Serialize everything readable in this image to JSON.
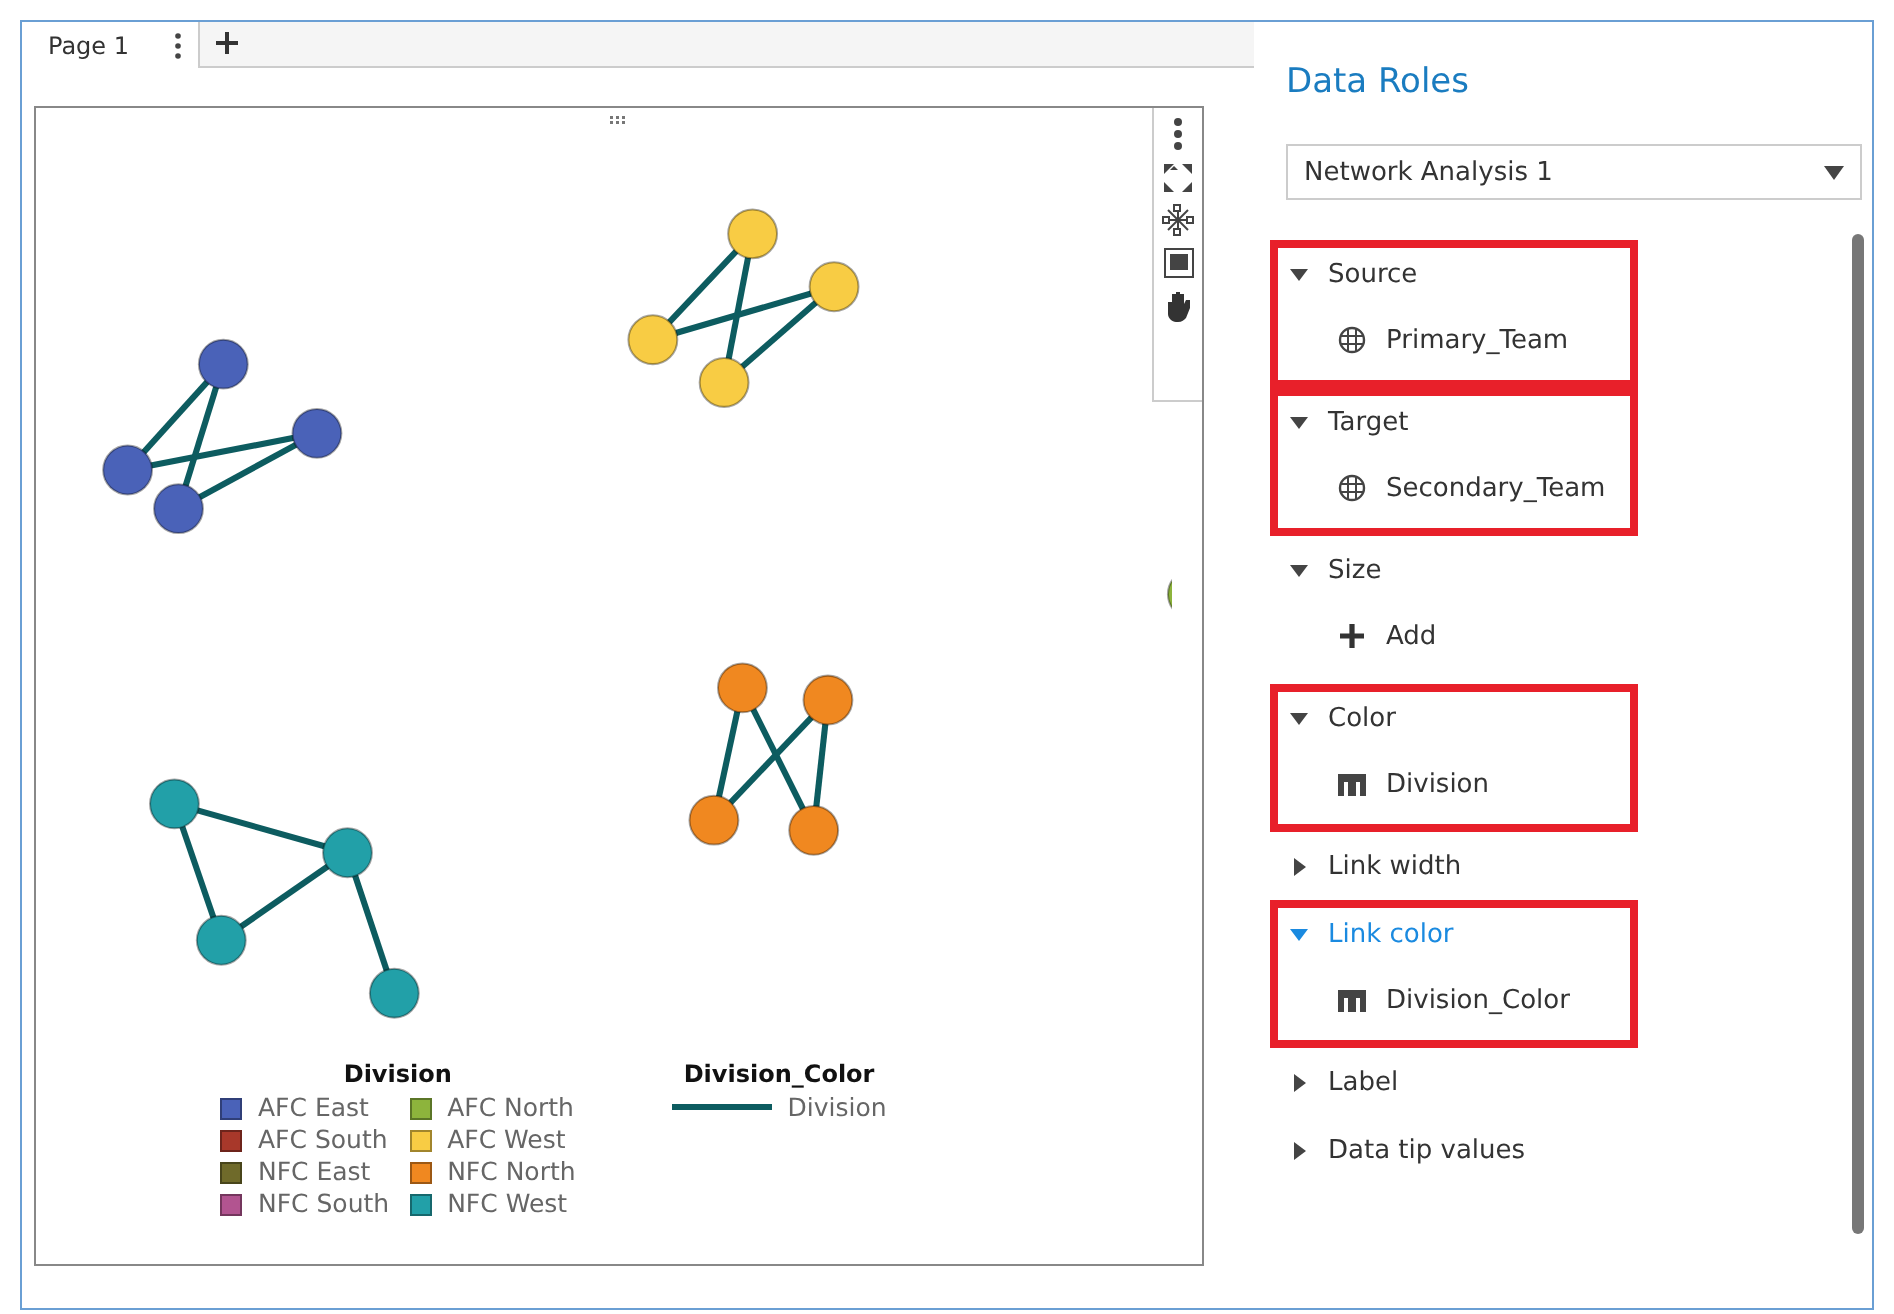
{
  "tabs": [
    {
      "label": "Page 1",
      "selected": true
    }
  ],
  "legend": {
    "title": "Division",
    "items": [
      {
        "label": "AFC East",
        "color": "#4a62b8"
      },
      {
        "label": "AFC North",
        "color": "#8db43c"
      },
      {
        "label": "AFC South",
        "color": "#a8382a"
      },
      {
        "label": "AFC West",
        "color": "#f8cc44"
      },
      {
        "label": "NFC East",
        "color": "#6f6a2a"
      },
      {
        "label": "NFC North",
        "color": "#f08820"
      },
      {
        "label": "NFC South",
        "color": "#b25490"
      },
      {
        "label": "NFC West",
        "color": "#22a0a8"
      }
    ]
  },
  "link_legend": {
    "title": "Division_Color",
    "label": "Division",
    "color": "#0d5c60"
  },
  "panel": {
    "title": "Data Roles",
    "dropdown": "Network Analysis 1",
    "roles": [
      {
        "label": "Source",
        "expanded": true,
        "highlighted": true,
        "selected": false,
        "item": {
          "kind": "field",
          "label": "Primary_Team"
        }
      },
      {
        "label": "Target",
        "expanded": true,
        "highlighted": true,
        "selected": false,
        "item": {
          "kind": "field",
          "label": "Secondary_Team"
        }
      },
      {
        "label": "Size",
        "expanded": true,
        "highlighted": false,
        "selected": false,
        "item": {
          "kind": "add",
          "label": "Add"
        }
      },
      {
        "label": "Color",
        "expanded": true,
        "highlighted": true,
        "selected": false,
        "item": {
          "kind": "category",
          "label": "Division"
        }
      },
      {
        "label": "Link width",
        "expanded": false,
        "highlighted": false,
        "selected": false
      },
      {
        "label": "Link color",
        "expanded": true,
        "highlighted": true,
        "selected": true,
        "item": {
          "kind": "category",
          "label": "Division_Color"
        }
      },
      {
        "label": "Label",
        "expanded": false,
        "highlighted": false,
        "selected": false
      },
      {
        "label": "Data tip values",
        "expanded": false,
        "highlighted": false,
        "selected": false
      }
    ]
  }
}
